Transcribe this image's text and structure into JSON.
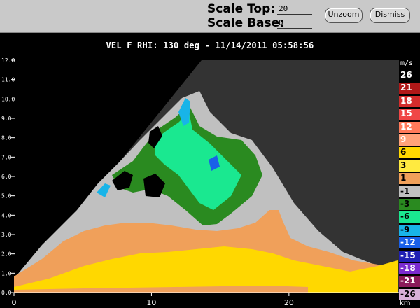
{
  "controls": {
    "scale_top_label": "Scale Top:",
    "scale_top_value": "20",
    "scale_base_label": "Scale Base:",
    "scale_base_value": "0",
    "unzoom_label": "Unzoom",
    "dismiss_label": "Dismiss"
  },
  "display": {
    "title": "VEL F  RHI: 130 deg  -  11/14/2011 05:58:56"
  },
  "axes": {
    "x_unit": "km",
    "x_ticks": [
      "0",
      "10",
      "20"
    ],
    "y_ticks": [
      "0.0",
      "1.0",
      "2.0",
      "3.0",
      "4.0",
      "5.0",
      "6.0",
      "7.0",
      "8.0",
      "9.0",
      "10.0",
      "11.0",
      "12.0"
    ],
    "x_range": [
      0,
      28
    ],
    "y_range": [
      0,
      12
    ]
  },
  "colorbar": {
    "unit": "m/s",
    "entries": [
      {
        "label": "26",
        "bg": "#000000",
        "fg": "#ffffff"
      },
      {
        "label": "21",
        "bg": "#b01818",
        "fg": "#ffffff"
      },
      {
        "label": "18",
        "bg": "#d42c2c",
        "fg": "#ffffff"
      },
      {
        "label": "15",
        "bg": "#f04646",
        "fg": "#ffffff"
      },
      {
        "label": "12",
        "bg": "#ff7a5a",
        "fg": "#ffffff"
      },
      {
        "label": "9",
        "bg": "#ffa27a",
        "fg": "#ffffff"
      },
      {
        "label": "6",
        "bg": "#ffd800",
        "fg": "#000000"
      },
      {
        "label": "3",
        "bg": "#ffea40",
        "fg": "#000000"
      },
      {
        "label": "1",
        "bg": "#f0a05a",
        "fg": "#000000"
      },
      {
        "label": "-1",
        "bg": "#c0c0c0",
        "fg": "#000000"
      },
      {
        "label": "-3",
        "bg": "#2a8a20",
        "fg": "#000000"
      },
      {
        "label": "-6",
        "bg": "#1ae890",
        "fg": "#000000"
      },
      {
        "label": "-9",
        "bg": "#18b4e8",
        "fg": "#000000"
      },
      {
        "label": "-12",
        "bg": "#1a60e8",
        "fg": "#ffffff"
      },
      {
        "label": "-15",
        "bg": "#2020b4",
        "fg": "#ffffff"
      },
      {
        "label": "-18",
        "bg": "#7a2ad0",
        "fg": "#ffffff"
      },
      {
        "label": "-21",
        "bg": "#8a1a5a",
        "fg": "#ffffff"
      },
      {
        "label": "-26",
        "bg": "#d8b0d8",
        "fg": "#000000"
      }
    ]
  },
  "palette": {
    "nodata_bg": "#333333",
    "outside_bg": "#000000",
    "near_zero": "#c0c0c0",
    "light_orange": "#f0a05a",
    "yellow": "#ffd800",
    "dark_green": "#2a8a20",
    "aqua": "#1ae890",
    "cyan": "#18b4e8",
    "blue": "#1a60e8"
  }
}
